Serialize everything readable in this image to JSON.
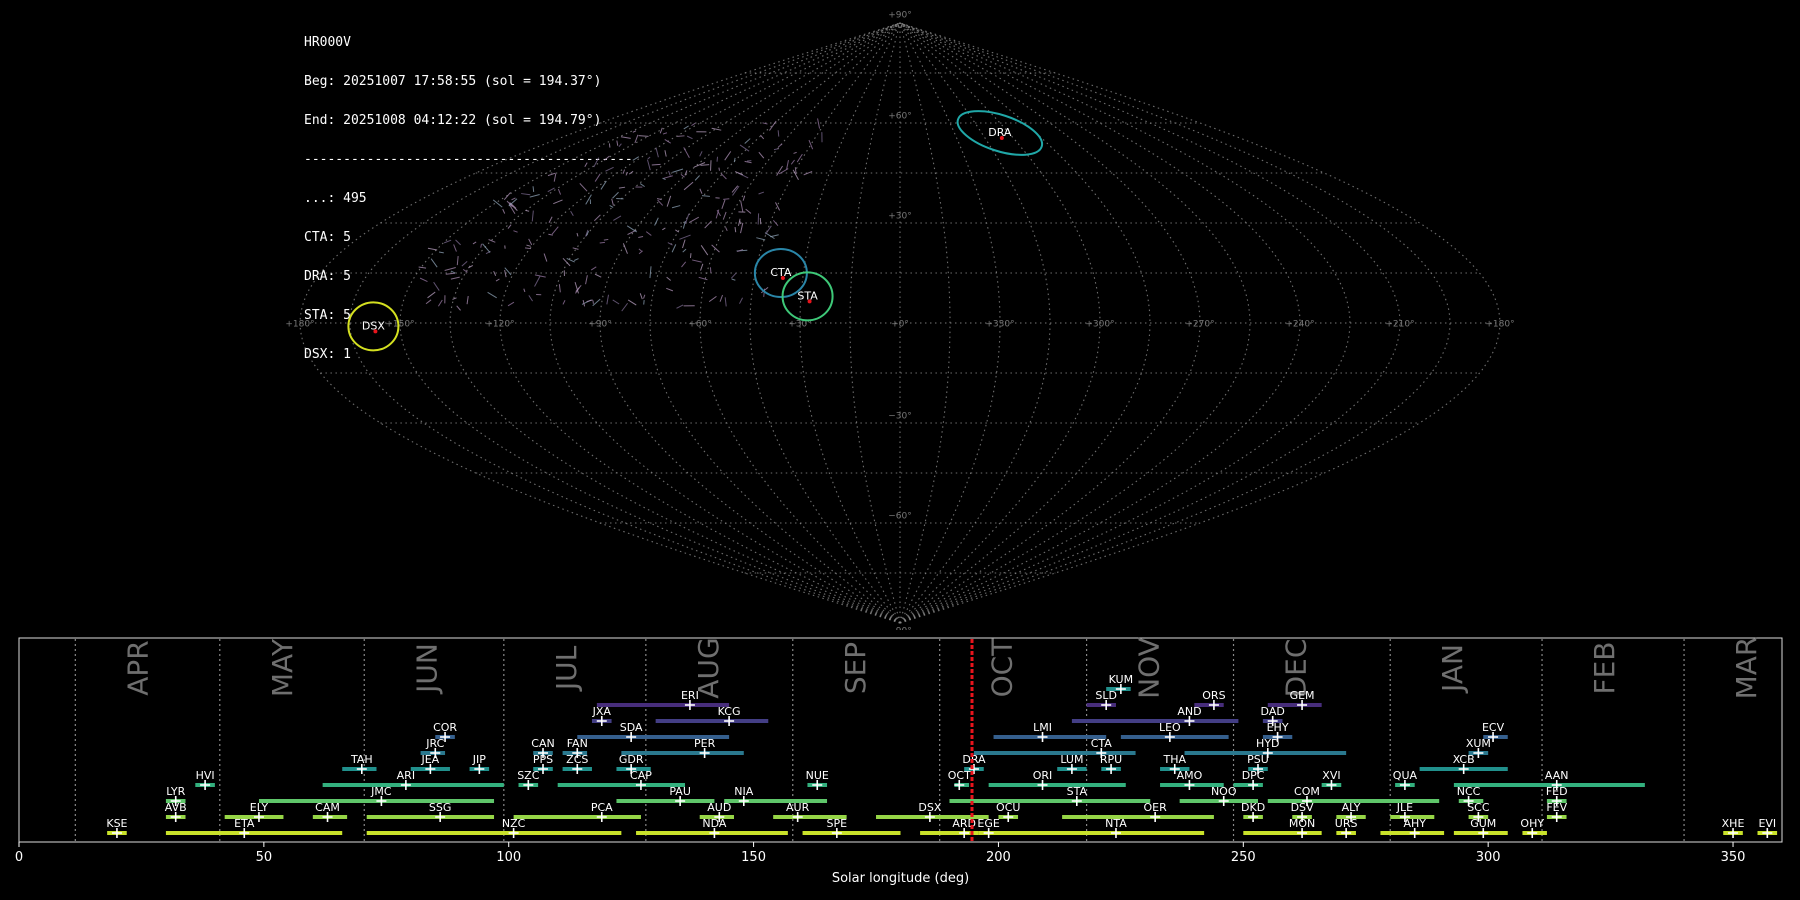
{
  "stats": {
    "station": "HR000V",
    "beg": "Beg: 20251007 17:58:55 (sol = 194.37°)",
    "end": "End: 20251008 04:12:22 (sol = 194.79°)",
    "separator": "------------------------------------------",
    "counts": [
      {
        "label": "...",
        "value": "495"
      },
      {
        "label": "CTA",
        "value": "5"
      },
      {
        "label": "DRA",
        "value": "5"
      },
      {
        "label": "STA",
        "value": "5"
      },
      {
        "label": "DSX",
        "value": "1"
      }
    ]
  },
  "colors": {
    "background": "#000000",
    "grid": "#8a8a8a",
    "solar_marker": "#e8141c",
    "month_text": "#6f6f6f"
  },
  "chart_data": [
    {
      "type": "scatter",
      "projection": "sinusoidal",
      "lon_ticks": [
        "+180°",
        "+150°",
        "+120°",
        "+90°",
        "+60°",
        "+30°",
        "+0°",
        "+330°",
        "+300°",
        "+270°",
        "+240°",
        "+210°",
        "+180°"
      ],
      "lat_ticks": [
        "+90°",
        "+60°",
        "+30°",
        "−30°",
        "−60°",
        "−90°"
      ],
      "grid": true,
      "shower_radiants": [
        {
          "code": "DRA",
          "lon": -55,
          "lat": 57,
          "color": "#20a8a8"
        },
        {
          "code": "CTA",
          "lon": 37,
          "lat": 15,
          "color": "#2a86a8"
        },
        {
          "code": "STA",
          "lon": 28,
          "lat": 8,
          "color": "#3ec878"
        },
        {
          "code": "DSX",
          "lon": 158,
          "lat": -1,
          "color": "#d4e020"
        }
      ]
    },
    {
      "type": "timeline",
      "xlabel": "Solar longitude (deg)",
      "xlim": [
        0,
        360
      ],
      "x_ticks": [
        0,
        50,
        100,
        150,
        200,
        250,
        300,
        350
      ],
      "current_solar_longitude": 194.6,
      "months": [
        {
          "name": "APR",
          "start": 11.5
        },
        {
          "name": "MAY",
          "start": 41
        },
        {
          "name": "JUN",
          "start": 70.5
        },
        {
          "name": "JUL",
          "start": 99
        },
        {
          "name": "AUG",
          "start": 128
        },
        {
          "name": "SEP",
          "start": 158
        },
        {
          "name": "OCT",
          "start": 188
        },
        {
          "name": "NOV",
          "start": 218
        },
        {
          "name": "DEC",
          "start": 248
        },
        {
          "name": "JAN",
          "start": 280
        },
        {
          "name": "FEB",
          "start": 311
        },
        {
          "name": "MAR",
          "start": 340
        }
      ],
      "showers": [
        {
          "code": "KUM",
          "peak": 225,
          "start": 222,
          "end": 227,
          "row": 9
        },
        {
          "code": "ERI",
          "peak": 137,
          "start": 118,
          "end": 145,
          "row": 8
        },
        {
          "code": "SLD",
          "peak": 222,
          "start": 218,
          "end": 224,
          "row": 8
        },
        {
          "code": "ORS",
          "peak": 244,
          "start": 240,
          "end": 246,
          "row": 8
        },
        {
          "code": "GEM",
          "peak": 262,
          "start": 255,
          "end": 266,
          "row": 8
        },
        {
          "code": "JXA",
          "peak": 119,
          "start": 117,
          "end": 121,
          "row": 7
        },
        {
          "code": "KCG",
          "peak": 145,
          "start": 130,
          "end": 153,
          "row": 7
        },
        {
          "code": "AND",
          "peak": 239,
          "start": 215,
          "end": 249,
          "row": 7
        },
        {
          "code": "DAD",
          "peak": 256,
          "start": 254,
          "end": 258,
          "row": 7
        },
        {
          "code": "COR",
          "peak": 87,
          "start": 85,
          "end": 89,
          "row": 6
        },
        {
          "code": "SDA",
          "peak": 125,
          "start": 114,
          "end": 145,
          "row": 6
        },
        {
          "code": "LMI",
          "peak": 209,
          "start": 199,
          "end": 222,
          "row": 6
        },
        {
          "code": "LEO",
          "peak": 235,
          "start": 225,
          "end": 247,
          "row": 6
        },
        {
          "code": "EHY",
          "peak": 257,
          "start": 254,
          "end": 260,
          "row": 6
        },
        {
          "code": "ECV",
          "peak": 301,
          "start": 299,
          "end": 304,
          "row": 6
        },
        {
          "code": "JRC",
          "peak": 85,
          "start": 82,
          "end": 87,
          "row": 5
        },
        {
          "code": "CAN",
          "peak": 107,
          "start": 105,
          "end": 109,
          "row": 5
        },
        {
          "code": "FAN",
          "peak": 114,
          "start": 111,
          "end": 116,
          "row": 5
        },
        {
          "code": "PER",
          "peak": 140,
          "start": 123,
          "end": 148,
          "row": 5
        },
        {
          "code": "CTA",
          "peak": 221,
          "start": 195,
          "end": 228,
          "row": 5
        },
        {
          "code": "HYD",
          "peak": 255,
          "start": 238,
          "end": 271,
          "row": 5
        },
        {
          "code": "XUM",
          "peak": 298,
          "start": 296,
          "end": 300,
          "row": 5
        },
        {
          "code": "TAH",
          "peak": 70,
          "start": 66,
          "end": 73,
          "row": 4
        },
        {
          "code": "JEA",
          "peak": 84,
          "start": 80,
          "end": 88,
          "row": 4
        },
        {
          "code": "JIP",
          "peak": 94,
          "start": 92,
          "end": 96,
          "row": 4
        },
        {
          "code": "PPS",
          "peak": 107,
          "start": 105,
          "end": 109,
          "row": 4
        },
        {
          "code": "ZCS",
          "peak": 114,
          "start": 111,
          "end": 117,
          "row": 4
        },
        {
          "code": "GDR",
          "peak": 125,
          "start": 122,
          "end": 129,
          "row": 4
        },
        {
          "code": "DRA",
          "peak": 195,
          "start": 193,
          "end": 197,
          "row": 4
        },
        {
          "code": "LUM",
          "peak": 215,
          "start": 212,
          "end": 218,
          "row": 4
        },
        {
          "code": "RPU",
          "peak": 223,
          "start": 221,
          "end": 225,
          "row": 4
        },
        {
          "code": "THA",
          "peak": 236,
          "start": 233,
          "end": 239,
          "row": 4
        },
        {
          "code": "PSU",
          "peak": 253,
          "start": 251,
          "end": 255,
          "row": 4
        },
        {
          "code": "XCB",
          "peak": 295,
          "start": 286,
          "end": 304,
          "row": 4
        },
        {
          "code": "HVI",
          "peak": 38,
          "start": 36,
          "end": 40,
          "row": 3
        },
        {
          "code": "ARI",
          "peak": 79,
          "start": 62,
          "end": 99,
          "row": 3
        },
        {
          "code": "SZC",
          "peak": 104,
          "start": 102,
          "end": 106,
          "row": 3
        },
        {
          "code": "CAP",
          "peak": 127,
          "start": 110,
          "end": 136,
          "row": 3
        },
        {
          "code": "NUE",
          "peak": 163,
          "start": 161,
          "end": 165,
          "row": 3
        },
        {
          "code": "OCT",
          "peak": 192,
          "start": 191,
          "end": 194,
          "row": 3
        },
        {
          "code": "ORI",
          "peak": 209,
          "start": 198,
          "end": 226,
          "row": 3
        },
        {
          "code": "AMO",
          "peak": 239,
          "start": 233,
          "end": 246,
          "row": 3
        },
        {
          "code": "DPC",
          "peak": 252,
          "start": 248,
          "end": 254,
          "row": 3
        },
        {
          "code": "XVI",
          "peak": 268,
          "start": 266,
          "end": 270,
          "row": 3
        },
        {
          "code": "QUA",
          "peak": 283,
          "start": 281,
          "end": 285,
          "row": 3
        },
        {
          "code": "AAN",
          "peak": 314,
          "start": 293,
          "end": 332,
          "row": 3
        },
        {
          "code": "LYR",
          "peak": 32,
          "start": 30,
          "end": 34,
          "row": 2
        },
        {
          "code": "JMC",
          "peak": 74,
          "start": 49,
          "end": 97,
          "row": 2
        },
        {
          "code": "PAU",
          "peak": 135,
          "start": 122,
          "end": 142,
          "row": 2
        },
        {
          "code": "NIA",
          "peak": 148,
          "start": 144,
          "end": 165,
          "row": 2
        },
        {
          "code": "STA",
          "peak": 216,
          "start": 190,
          "end": 231,
          "row": 2
        },
        {
          "code": "NOO",
          "peak": 246,
          "start": 237,
          "end": 253,
          "row": 2
        },
        {
          "code": "COM",
          "peak": 263,
          "start": 255,
          "end": 290,
          "row": 2
        },
        {
          "code": "NCC",
          "peak": 296,
          "start": 294,
          "end": 299,
          "row": 2
        },
        {
          "code": "FED",
          "peak": 314,
          "start": 312,
          "end": 316,
          "row": 2
        },
        {
          "code": "AVB",
          "peak": 32,
          "start": 30,
          "end": 34,
          "row": 1
        },
        {
          "code": "ELY",
          "peak": 49,
          "start": 42,
          "end": 54,
          "row": 1
        },
        {
          "code": "CAM",
          "peak": 63,
          "start": 60,
          "end": 67,
          "row": 1
        },
        {
          "code": "SSG",
          "peak": 86,
          "start": 71,
          "end": 97,
          "row": 1
        },
        {
          "code": "PCA",
          "peak": 119,
          "start": 101,
          "end": 127,
          "row": 1
        },
        {
          "code": "AUD",
          "peak": 143,
          "start": 139,
          "end": 146,
          "row": 1
        },
        {
          "code": "AUR",
          "peak": 159,
          "start": 154,
          "end": 169,
          "row": 1
        },
        {
          "code": "DSX",
          "peak": 186,
          "start": 175,
          "end": 198,
          "row": 1
        },
        {
          "code": "OCU",
          "peak": 202,
          "start": 200,
          "end": 204,
          "row": 1
        },
        {
          "code": "OER",
          "peak": 232,
          "start": 213,
          "end": 244,
          "row": 1
        },
        {
          "code": "DKD",
          "peak": 252,
          "start": 250,
          "end": 254,
          "row": 1
        },
        {
          "code": "DSV",
          "peak": 262,
          "start": 260,
          "end": 264,
          "row": 1
        },
        {
          "code": "ALY",
          "peak": 272,
          "start": 269,
          "end": 275,
          "row": 1
        },
        {
          "code": "JLE",
          "peak": 283,
          "start": 280,
          "end": 289,
          "row": 1
        },
        {
          "code": "SCC",
          "peak": 298,
          "start": 296,
          "end": 300,
          "row": 1
        },
        {
          "code": "FEV",
          "peak": 314,
          "start": 312,
          "end": 316,
          "row": 1
        },
        {
          "code": "KSE",
          "peak": 20,
          "start": 18,
          "end": 22,
          "row": 0
        },
        {
          "code": "ETA",
          "peak": 46,
          "start": 30,
          "end": 66,
          "row": 0
        },
        {
          "code": "NZC",
          "peak": 101,
          "start": 71,
          "end": 123,
          "row": 0
        },
        {
          "code": "NDA",
          "peak": 142,
          "start": 126,
          "end": 157,
          "row": 0
        },
        {
          "code": "SPE",
          "peak": 167,
          "start": 160,
          "end": 180,
          "row": 0
        },
        {
          "code": "ARD",
          "peak": 193,
          "start": 184,
          "end": 196,
          "row": 0
        },
        {
          "code": "EGE",
          "peak": 198,
          "start": 196,
          "end": 214,
          "row": 0
        },
        {
          "code": "NTA",
          "peak": 224,
          "start": 205,
          "end": 242,
          "row": 0
        },
        {
          "code": "MON",
          "peak": 262,
          "start": 250,
          "end": 266,
          "row": 0
        },
        {
          "code": "URS",
          "peak": 271,
          "start": 269,
          "end": 273,
          "row": 0
        },
        {
          "code": "AHY",
          "peak": 285,
          "start": 278,
          "end": 291,
          "row": 0
        },
        {
          "code": "GUM",
          "peak": 299,
          "start": 293,
          "end": 304,
          "row": 0
        },
        {
          "code": "OHY",
          "peak": 309,
          "start": 307,
          "end": 312,
          "row": 0
        },
        {
          "code": "XHE",
          "peak": 350,
          "start": 348,
          "end": 352,
          "row": 0
        },
        {
          "code": "EVI",
          "peak": 357,
          "start": 355,
          "end": 359,
          "row": 0
        }
      ]
    }
  ]
}
